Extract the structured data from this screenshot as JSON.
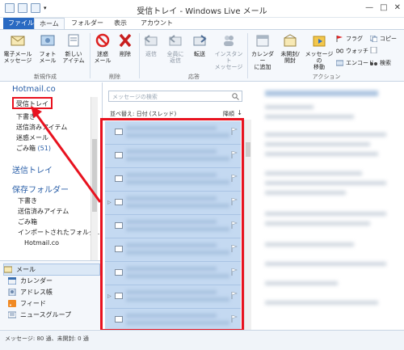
{
  "window": {
    "title": "受信トレイ - Windows Live メール"
  },
  "tabs": [
    "ファイル",
    "ホーム",
    "フォルダー",
    "表示",
    "アカウント"
  ],
  "ribbon": {
    "new_email": "電子メール\nメッセージ",
    "photo_email": "フォト\nメール",
    "new_item": "新しい\nアイテム",
    "junk": "迷惑\nメール",
    "delete": "削除",
    "reply": "返信",
    "reply_all": "全員に\n返信",
    "forward": "転送",
    "im": "インスタント\nメッセージ",
    "add_calendar": "カレンダー\nに追加",
    "unread_read": "未開封/\n開封",
    "move_message": "メッセージの\n移動",
    "flag": "フラグ",
    "watch": "ウォッチ",
    "encode": "エンコード",
    "copy": "コピー",
    "search": "検索",
    "group_new": "新規作成",
    "group_delete": "削除",
    "group_respond": "応答",
    "group_actions": "アクション"
  },
  "folders": {
    "account": "Hotmail.co",
    "items": [
      "受信トレイ",
      "下書き",
      "送信済みアイテム",
      "迷惑メール",
      "ごみ箱"
    ],
    "trash_count": "(51)",
    "outbox": "送信トレイ",
    "saved_header": "保存フォルダー",
    "saved_items": [
      "下書き",
      "送信済みアイテム",
      "ごみ箱",
      "インポートされたフォルダ…"
    ],
    "saved_account": "Hotmail.co"
  },
  "nav": [
    "メール",
    "カレンダー",
    "アドレス帳",
    "フィード",
    "ニュースグループ"
  ],
  "list": {
    "search_placeholder": "メッセージの検索",
    "sort_label": "並べ替え: 日付 (スレッド)",
    "order_label": "降順"
  },
  "status": {
    "text": "メッセージ: 80 通、未開封: 0 通"
  },
  "colors": {
    "accent": "#2a6ac2",
    "highlight": "#e8121f",
    "selection": "#c4d9f1"
  }
}
